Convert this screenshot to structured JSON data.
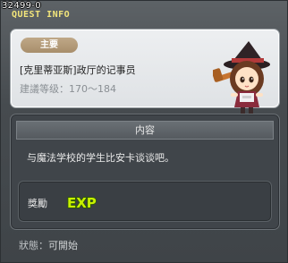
{
  "window": {
    "quest_id": "32499-0",
    "title": "QUEST INFO"
  },
  "summary": {
    "category": "主要",
    "quest_name": "[克里蒂亚斯]政厅的记事员",
    "level_text": "建議等级：170～184"
  },
  "content": {
    "header": "内容",
    "text": "与魔法学校的学生比安卡谈谈吧。"
  },
  "reward": {
    "label": "獎勵",
    "exp_icon": "exp-icon",
    "exp_text": "EXP"
  },
  "status": {
    "label": "狀態：",
    "value": "可開始"
  },
  "colors": {
    "title": "#f2e57b",
    "badge": "#a88e6b",
    "exp_fill": "#c8f000"
  }
}
